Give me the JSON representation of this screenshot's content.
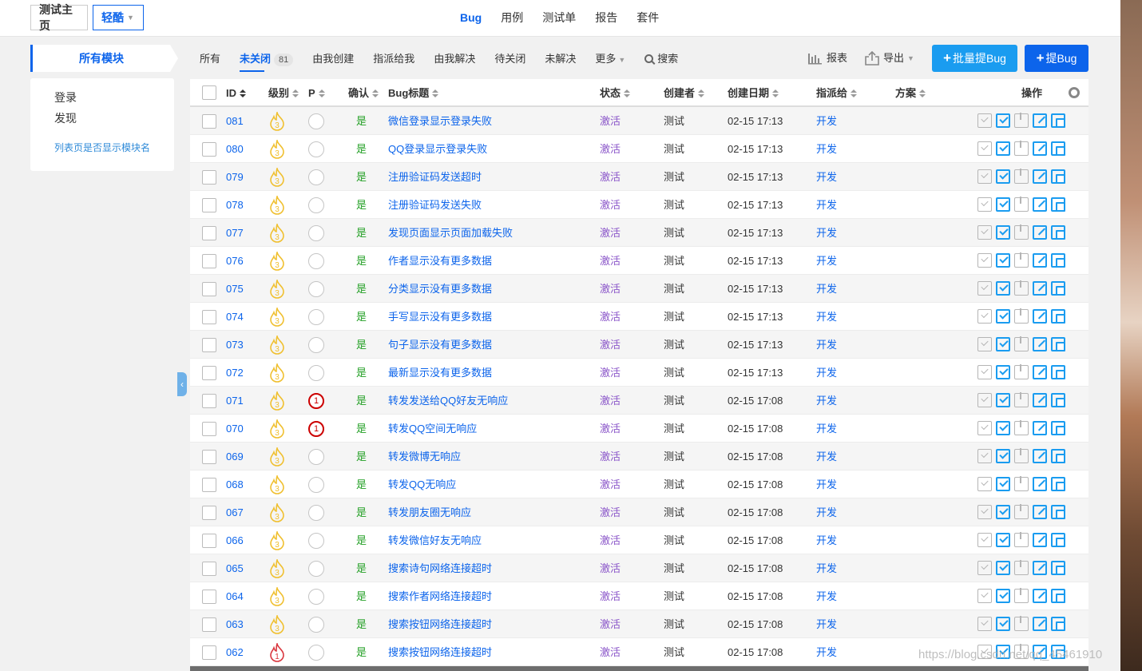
{
  "header": {
    "breadcrumb_home": "测试主页",
    "breadcrumb_product": "轻酷",
    "nav": [
      "Bug",
      "用例",
      "测试单",
      "报告",
      "套件"
    ],
    "nav_active": "Bug"
  },
  "sidebar": {
    "title": "所有模块",
    "modules": [
      "登录",
      "发现"
    ],
    "toggle_link": "列表页是否显示模块名"
  },
  "toolbar": {
    "tab_all": "所有",
    "tab_unclosed": "未关闭",
    "tab_unclosed_count": "81",
    "tab_created_by_me": "由我创建",
    "tab_assigned_to_me": "指派给我",
    "tab_resolved_by_me": "由我解决",
    "tab_to_close": "待关闭",
    "tab_unresolved": "未解决",
    "tab_more": "更多",
    "tab_search": "搜索",
    "report": "报表",
    "export": "导出",
    "batch_bug": "批量提Bug",
    "add_bug": "提Bug"
  },
  "table": {
    "headers": {
      "id": "ID",
      "severity": "级别",
      "priority": "P",
      "confirmed": "确认",
      "title": "Bug标题",
      "status": "状态",
      "creator": "创建者",
      "created": "创建日期",
      "assigned": "指派给",
      "resolution": "方案",
      "actions": "操作"
    },
    "rows": [
      {
        "id": "081",
        "sev": "3",
        "pri": "",
        "confirmed": "是",
        "title": "微信登录显示登录失败",
        "status": "激活",
        "creator": "测试",
        "date": "02-15 17:13",
        "assigned": "开发"
      },
      {
        "id": "080",
        "sev": "3",
        "pri": "",
        "confirmed": "是",
        "title": "QQ登录显示登录失败",
        "status": "激活",
        "creator": "测试",
        "date": "02-15 17:13",
        "assigned": "开发"
      },
      {
        "id": "079",
        "sev": "3",
        "pri": "",
        "confirmed": "是",
        "title": "注册验证码发送超时",
        "status": "激活",
        "creator": "测试",
        "date": "02-15 17:13",
        "assigned": "开发"
      },
      {
        "id": "078",
        "sev": "3",
        "pri": "",
        "confirmed": "是",
        "title": "注册验证码发送失败",
        "status": "激活",
        "creator": "测试",
        "date": "02-15 17:13",
        "assigned": "开发"
      },
      {
        "id": "077",
        "sev": "3",
        "pri": "",
        "confirmed": "是",
        "title": "发现页面显示页面加载失败",
        "status": "激活",
        "creator": "测试",
        "date": "02-15 17:13",
        "assigned": "开发"
      },
      {
        "id": "076",
        "sev": "3",
        "pri": "",
        "confirmed": "是",
        "title": "作者显示没有更多数据",
        "status": "激活",
        "creator": "测试",
        "date": "02-15 17:13",
        "assigned": "开发"
      },
      {
        "id": "075",
        "sev": "3",
        "pri": "",
        "confirmed": "是",
        "title": "分类显示没有更多数据",
        "status": "激活",
        "creator": "测试",
        "date": "02-15 17:13",
        "assigned": "开发"
      },
      {
        "id": "074",
        "sev": "3",
        "pri": "",
        "confirmed": "是",
        "title": "手写显示没有更多数据",
        "status": "激活",
        "creator": "测试",
        "date": "02-15 17:13",
        "assigned": "开发"
      },
      {
        "id": "073",
        "sev": "3",
        "pri": "",
        "confirmed": "是",
        "title": "句子显示没有更多数据",
        "status": "激活",
        "creator": "测试",
        "date": "02-15 17:13",
        "assigned": "开发"
      },
      {
        "id": "072",
        "sev": "3",
        "pri": "",
        "confirmed": "是",
        "title": "最新显示没有更多数据",
        "status": "激活",
        "creator": "测试",
        "date": "02-15 17:13",
        "assigned": "开发"
      },
      {
        "id": "071",
        "sev": "3",
        "pri": "1",
        "confirmed": "是",
        "title": "转发发送给QQ好友无响应",
        "status": "激活",
        "creator": "测试",
        "date": "02-15 17:08",
        "assigned": "开发"
      },
      {
        "id": "070",
        "sev": "3",
        "pri": "1",
        "confirmed": "是",
        "title": "转发QQ空间无响应",
        "status": "激活",
        "creator": "测试",
        "date": "02-15 17:08",
        "assigned": "开发"
      },
      {
        "id": "069",
        "sev": "3",
        "pri": "",
        "confirmed": "是",
        "title": "转发微博无响应",
        "status": "激活",
        "creator": "测试",
        "date": "02-15 17:08",
        "assigned": "开发"
      },
      {
        "id": "068",
        "sev": "3",
        "pri": "",
        "confirmed": "是",
        "title": "转发QQ无响应",
        "status": "激活",
        "creator": "测试",
        "date": "02-15 17:08",
        "assigned": "开发"
      },
      {
        "id": "067",
        "sev": "3",
        "pri": "",
        "confirmed": "是",
        "title": "转发朋友圈无响应",
        "status": "激活",
        "creator": "测试",
        "date": "02-15 17:08",
        "assigned": "开发"
      },
      {
        "id": "066",
        "sev": "3",
        "pri": "",
        "confirmed": "是",
        "title": "转发微信好友无响应",
        "status": "激活",
        "creator": "测试",
        "date": "02-15 17:08",
        "assigned": "开发"
      },
      {
        "id": "065",
        "sev": "3",
        "pri": "",
        "confirmed": "是",
        "title": "搜索诗句网络连接超时",
        "status": "激活",
        "creator": "测试",
        "date": "02-15 17:08",
        "assigned": "开发"
      },
      {
        "id": "064",
        "sev": "3",
        "pri": "",
        "confirmed": "是",
        "title": "搜索作者网络连接超时",
        "status": "激活",
        "creator": "测试",
        "date": "02-15 17:08",
        "assigned": "开发"
      },
      {
        "id": "063",
        "sev": "3",
        "pri": "",
        "confirmed": "是",
        "title": "搜索按钮网络连接超时",
        "status": "激活",
        "creator": "测试",
        "date": "02-15 17:08",
        "assigned": "开发"
      },
      {
        "id": "062",
        "sev": "1",
        "pri": "",
        "confirmed": "是",
        "title": "搜索按钮网络连接超时",
        "status": "激活",
        "creator": "测试",
        "date": "02-15 17:08",
        "assigned": "开发"
      }
    ]
  },
  "watermark": "https://blog.csdn.net/qq_45461910",
  "colors": {
    "primary": "#0c64eb",
    "batch_button": "#1a9cf0",
    "status_active": "#8a55c9",
    "confirmed": "#229f24",
    "severity_3": "#f0c030",
    "severity_1": "#d9363e"
  },
  "icons": {
    "severity": "flame-icon",
    "report": "bar-chart-icon",
    "export": "export-icon",
    "settings": "gear-icon",
    "collapse": "chevron-left-icon"
  }
}
